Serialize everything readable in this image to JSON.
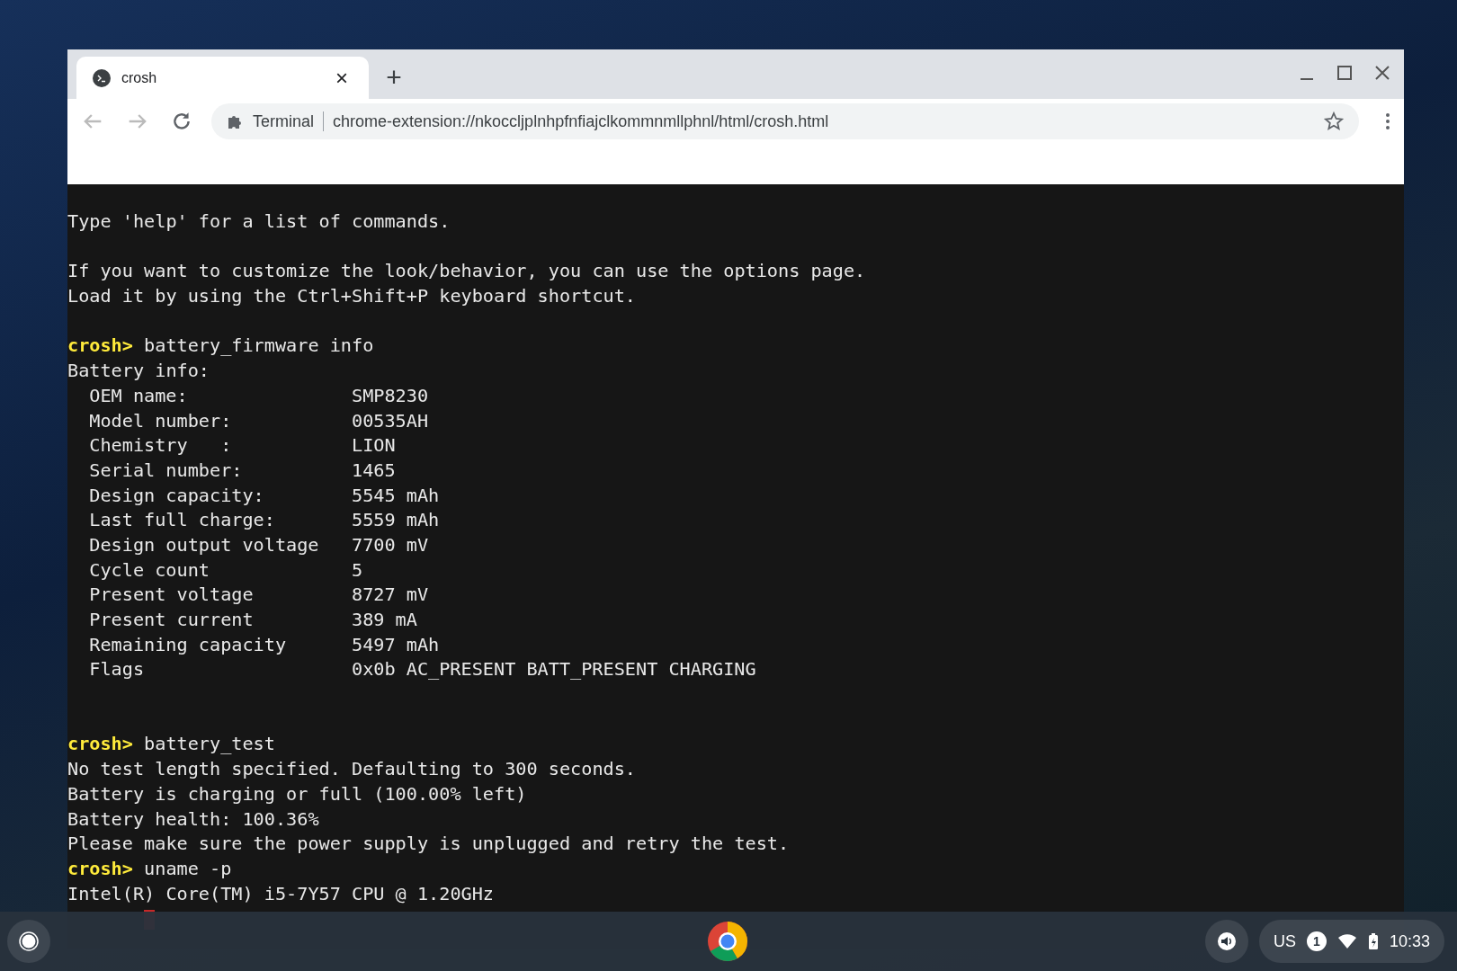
{
  "window": {
    "tabs": [
      {
        "title": "crosh",
        "selected": true,
        "close": "×"
      }
    ],
    "new_tab": "+"
  },
  "toolbar": {
    "site_label": "Terminal",
    "url": "chrome-extension://nkoccljplnhpfnfiajclkommnmllphnl/html/crosh.html"
  },
  "terminal": {
    "lines": [
      {
        "kind": "text",
        "text": "Type 'help' for a list of commands."
      },
      {
        "kind": "blank"
      },
      {
        "kind": "text",
        "text": "If you want to customize the look/behavior, you can use the options page."
      },
      {
        "kind": "text",
        "text": "Load it by using the Ctrl+Shift+P keyboard shortcut."
      },
      {
        "kind": "blank"
      },
      {
        "kind": "prompt",
        "prompt": "crosh>",
        "command": "battery_firmware info"
      },
      {
        "kind": "text",
        "text": "Battery info:"
      },
      {
        "kind": "field",
        "label": "OEM name:",
        "value": "SMP8230"
      },
      {
        "kind": "field",
        "label": "Model number:",
        "value": "00535AH"
      },
      {
        "kind": "field",
        "label": "Chemistry   :",
        "value": "LION"
      },
      {
        "kind": "field",
        "label": "Serial number:",
        "value": "1465"
      },
      {
        "kind": "field",
        "label": "Design capacity:",
        "value": "5545 mAh"
      },
      {
        "kind": "field",
        "label": "Last full charge:",
        "value": "5559 mAh"
      },
      {
        "kind": "field",
        "label": "Design output voltage",
        "value": "7700 mV"
      },
      {
        "kind": "field",
        "label": "Cycle count",
        "value": "5"
      },
      {
        "kind": "field",
        "label": "Present voltage",
        "value": "8727 mV"
      },
      {
        "kind": "field",
        "label": "Present current",
        "value": "389 mA"
      },
      {
        "kind": "field",
        "label": "Remaining capacity",
        "value": "5497 mAh"
      },
      {
        "kind": "field",
        "label": "Flags",
        "value": "0x0b AC_PRESENT BATT_PRESENT CHARGING"
      },
      {
        "kind": "blank"
      },
      {
        "kind": "blank"
      },
      {
        "kind": "prompt",
        "prompt": "crosh>",
        "command": "battery_test"
      },
      {
        "kind": "text",
        "text": "No test length specified. Defaulting to 300 seconds."
      },
      {
        "kind": "text",
        "text": "Battery is charging or full (100.00% left)"
      },
      {
        "kind": "text",
        "text": "Battery health: 100.36%"
      },
      {
        "kind": "text",
        "text": "Please make sure the power supply is unplugged and retry the test."
      },
      {
        "kind": "prompt",
        "prompt": "crosh>",
        "command": "uname -p"
      },
      {
        "kind": "text",
        "text": "Intel(R) Core(TM) i5-7Y57 CPU @ 1.20GHz"
      },
      {
        "kind": "cursor"
      }
    ]
  },
  "shelf": {
    "ime": "US",
    "notification_count": "1",
    "time": "10:33"
  }
}
